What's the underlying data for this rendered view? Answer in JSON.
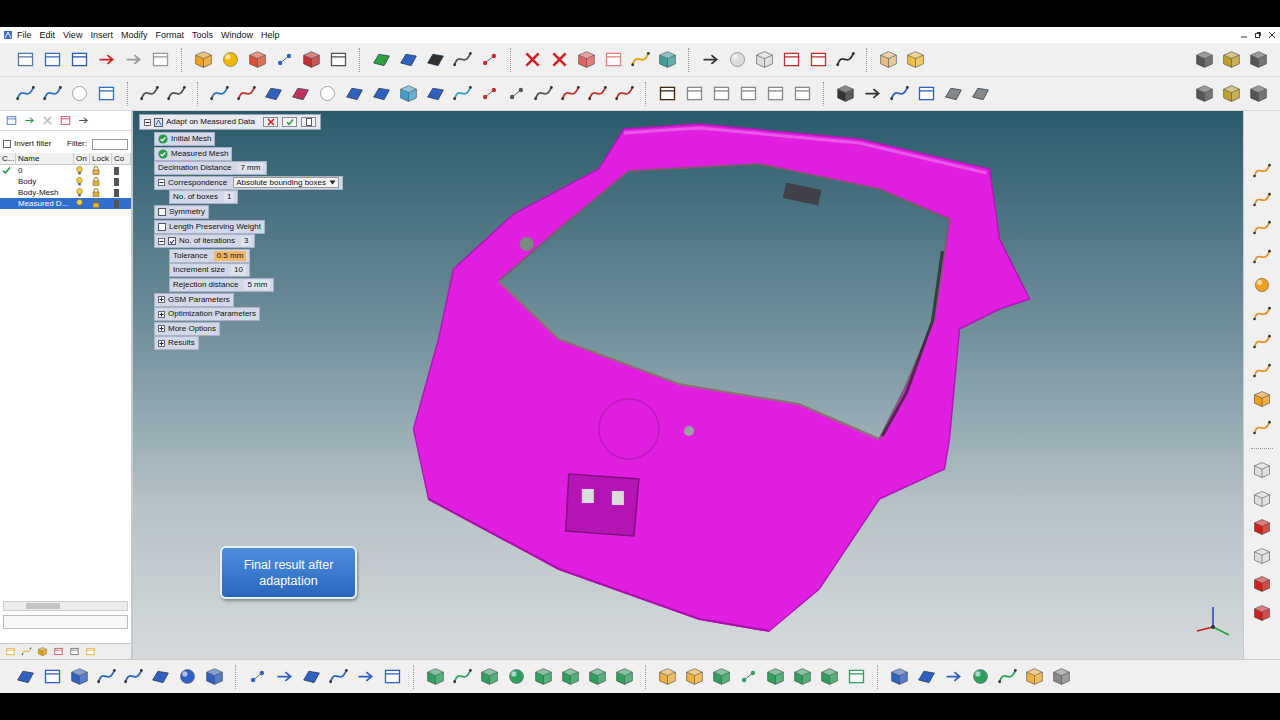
{
  "menu": [
    "File",
    "Edit",
    "View",
    "Insert",
    "Modify",
    "Format",
    "Tools",
    "Window",
    "Help"
  ],
  "left_panel": {
    "invert_filter": {
      "label": "Invert filter",
      "checked": false
    },
    "filter_label": "Filter:",
    "columns": [
      "C...",
      "Name",
      "On",
      "Lock",
      "Co"
    ],
    "rows": [
      {
        "name": "0",
        "current": true,
        "selected": false
      },
      {
        "name": "Body",
        "current": false,
        "selected": false
      },
      {
        "name": "Body-Mesh",
        "current": false,
        "selected": false
      },
      {
        "name": "Measured D...",
        "current": false,
        "selected": true
      }
    ]
  },
  "properties": {
    "title": "Adapt on Measured Data",
    "expanded": true,
    "items": [
      {
        "kind": "status",
        "label": "Initial Mesh",
        "ok": true
      },
      {
        "kind": "status",
        "label": "Measured Mesh",
        "ok": true
      },
      {
        "kind": "value",
        "label": "Decimation Distance",
        "value": "7 mm",
        "highlighted": false
      },
      {
        "kind": "dropdown",
        "label": "Correspondence",
        "value": "Absolute bounding boxes",
        "expanded": true,
        "children": [
          {
            "kind": "value",
            "label": "No. of boxes",
            "value": "1",
            "highlighted": false
          }
        ]
      },
      {
        "kind": "checkbox",
        "label": "Symmetry",
        "checked": false
      },
      {
        "kind": "checkbox",
        "label": "Length Preserving Weight",
        "checked": false
      },
      {
        "kind": "checkbox",
        "label": "No. of iterations",
        "value": "3",
        "checked": true,
        "expanded": true,
        "highlighted": false,
        "children": [
          {
            "kind": "value",
            "label": "Tolerance",
            "value": "0.5 mm",
            "highlighted": true
          },
          {
            "kind": "value",
            "label": "Increment size",
            "value": "10",
            "highlighted": false
          },
          {
            "kind": "value",
            "label": "Rejection distance",
            "value": "5 mm",
            "highlighted": false
          }
        ]
      },
      {
        "kind": "group",
        "label": "GSM Parameters",
        "expanded": false
      },
      {
        "kind": "group",
        "label": "Optimization Parameters",
        "expanded": false
      },
      {
        "kind": "group",
        "label": "More Options",
        "expanded": false
      },
      {
        "kind": "group",
        "label": "Results",
        "expanded": false
      }
    ]
  },
  "caption": "Final result after adaptation"
}
